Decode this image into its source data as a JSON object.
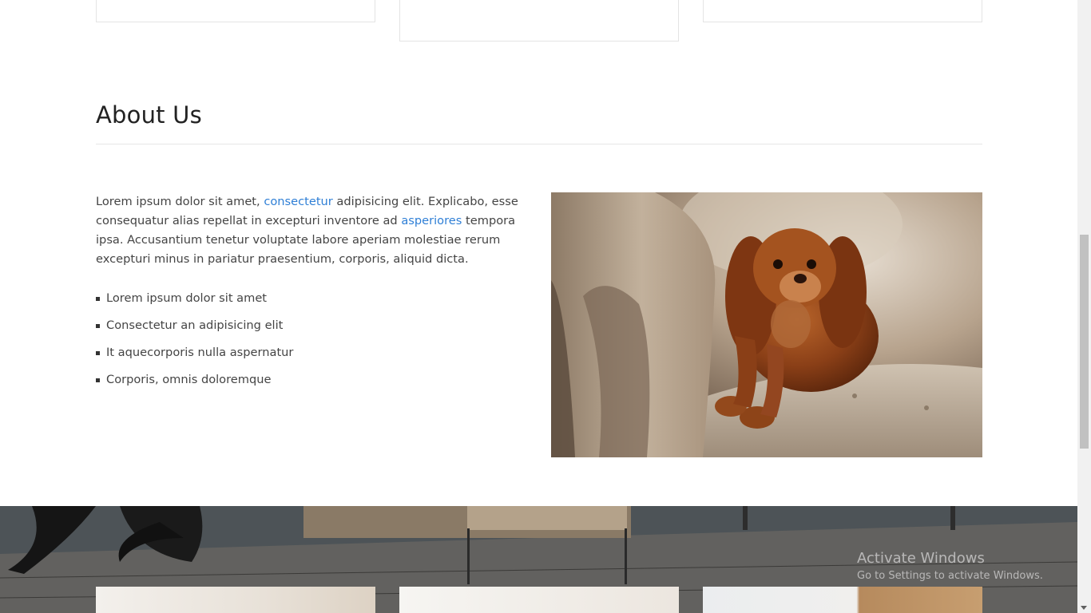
{
  "about": {
    "title": "About Us",
    "paragraph": {
      "p1": "Lorem ipsum dolor sit amet, ",
      "link1": "consectetur",
      "p2": " adipisicing elit. Explicabo, esse consequatur alias repellat in excepturi inventore ad ",
      "link2": "asperiores",
      "p3": " tempora ipsa. Accusantium tenetur voluptate labore aperiam molestiae rerum excepturi minus in pariatur praesentium, corporis, aliquid dicta."
    },
    "features": [
      "Lorem ipsum dolor sit amet",
      "Consectetur an adipisicing elit",
      "It aquecorporis nulla aspernatur",
      "Corporis, omnis doloremque"
    ],
    "link_color": "#2f7fd6"
  },
  "watermark": {
    "line1": "Activate Windows",
    "line2": "Go to Settings to activate Windows."
  }
}
